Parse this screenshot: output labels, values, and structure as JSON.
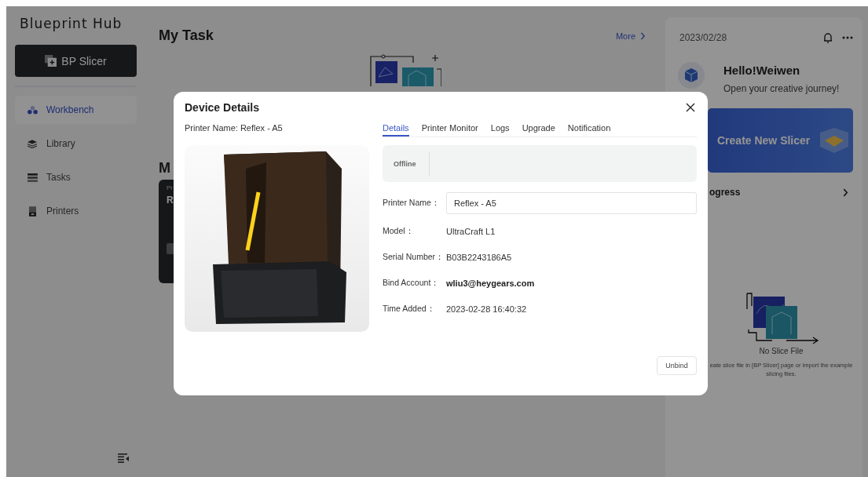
{
  "sidebar": {
    "logo": "Blueprint Hub",
    "slicer_button": "BP Slicer",
    "items": [
      {
        "label": "Workbench",
        "selected": true
      },
      {
        "label": "Library",
        "selected": false
      },
      {
        "label": "Tasks",
        "selected": false
      },
      {
        "label": "Printers",
        "selected": false
      }
    ]
  },
  "main": {
    "title": "My Task",
    "more_link": "More",
    "section_title": "M",
    "task_card": {
      "caption": "Pr",
      "name": "R"
    }
  },
  "modal": {
    "title": "Device Details",
    "printer_caption": "Printer Name: Reflex - A5",
    "tabs": [
      {
        "label": "Details",
        "selected": true
      },
      {
        "label": "Printer Monitor",
        "selected": false
      },
      {
        "label": "Logs",
        "selected": false
      },
      {
        "label": "Upgrade",
        "selected": false
      },
      {
        "label": "Notification",
        "selected": false
      }
    ],
    "status": "Offline",
    "fields": [
      {
        "kind": "input",
        "label": "Printer Name：",
        "value": "Reflex - A5"
      },
      {
        "kind": "text",
        "label": "Model：",
        "value": "UltraCraft L1"
      },
      {
        "kind": "text",
        "label": "Serial Number：",
        "value": "B03B2243186A5"
      },
      {
        "kind": "bold",
        "label": "Bind Account：",
        "value": "wliu3@heygears.com"
      },
      {
        "kind": "text",
        "label": "Time Added：",
        "value": "2023-02-28 16:40:32"
      }
    ],
    "unbind_button": "Unbind"
  },
  "right_panel": {
    "date": "2023/02/28",
    "greeting": "Hello!Weiwen",
    "subtitle": "Open your creative journey!",
    "banner": "Create New Slicer",
    "progress_title": "ogress",
    "empty_title": "No Slice File",
    "empty_text": "eate slice file in [BP Slicer] page or import the example slicing files."
  }
}
